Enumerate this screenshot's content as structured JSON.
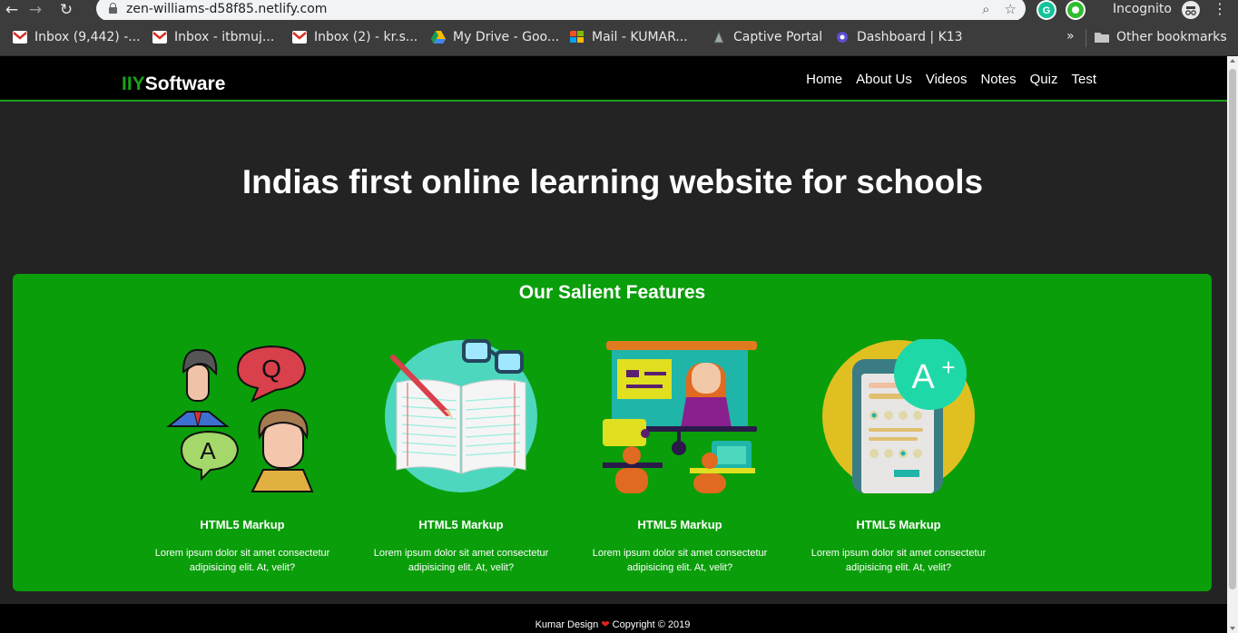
{
  "browser": {
    "url": "zen-williams-d58f85.netlify.com",
    "incognito_label": "Incognito",
    "other_bookmarks": "Other bookmarks",
    "more_bookmarks": "»",
    "bookmarks": [
      {
        "label": "Inbox (9,442) -...",
        "icon": "gmail-icon"
      },
      {
        "label": "Inbox - itbmuj...",
        "icon": "gmail-icon"
      },
      {
        "label": "Inbox (2) - kr.s...",
        "icon": "gmail-icon"
      },
      {
        "label": "My Drive - Goo...",
        "icon": "drive-icon"
      },
      {
        "label": "Mail - KUMAR...",
        "icon": "outlook-icon"
      },
      {
        "label": "Captive Portal",
        "icon": "portal-icon"
      },
      {
        "label": "Dashboard | K13",
        "icon": "dashboard-icon"
      }
    ]
  },
  "site": {
    "brand_accent": "IIY",
    "brand_rest": "Software",
    "nav": [
      "Home",
      "About Us",
      "Videos",
      "Notes",
      "Quiz",
      "Test"
    ],
    "hero_title": "Indias first online learning website for schools",
    "features_title": "Our Salient Features",
    "features": [
      {
        "icon": "qa-people-icon",
        "title": "HTML5 Markup",
        "desc": "Lorem ipsum dolor sit amet consectetur adipisicing elit. At, velit?"
      },
      {
        "icon": "open-book-icon",
        "title": "HTML5 Markup",
        "desc": "Lorem ipsum dolor sit amet consectetur adipisicing elit. At, velit?"
      },
      {
        "icon": "classroom-presentation-icon",
        "title": "HTML5 Markup",
        "desc": "Lorem ipsum dolor sit amet consectetur adipisicing elit. At, velit?"
      },
      {
        "icon": "grade-a-plus-icon",
        "title": "HTML5 Markup",
        "desc": "Lorem ipsum dolor sit amet consectetur adipisicing elit. At, velit?"
      }
    ],
    "footer_before": "Kumar Design",
    "footer_after": "Copyright © 2019"
  },
  "colors": {
    "accent": "#16a316",
    "features_bg": "#0a9e0a",
    "page_bg": "#232323",
    "navbar_bg": "#000000"
  }
}
